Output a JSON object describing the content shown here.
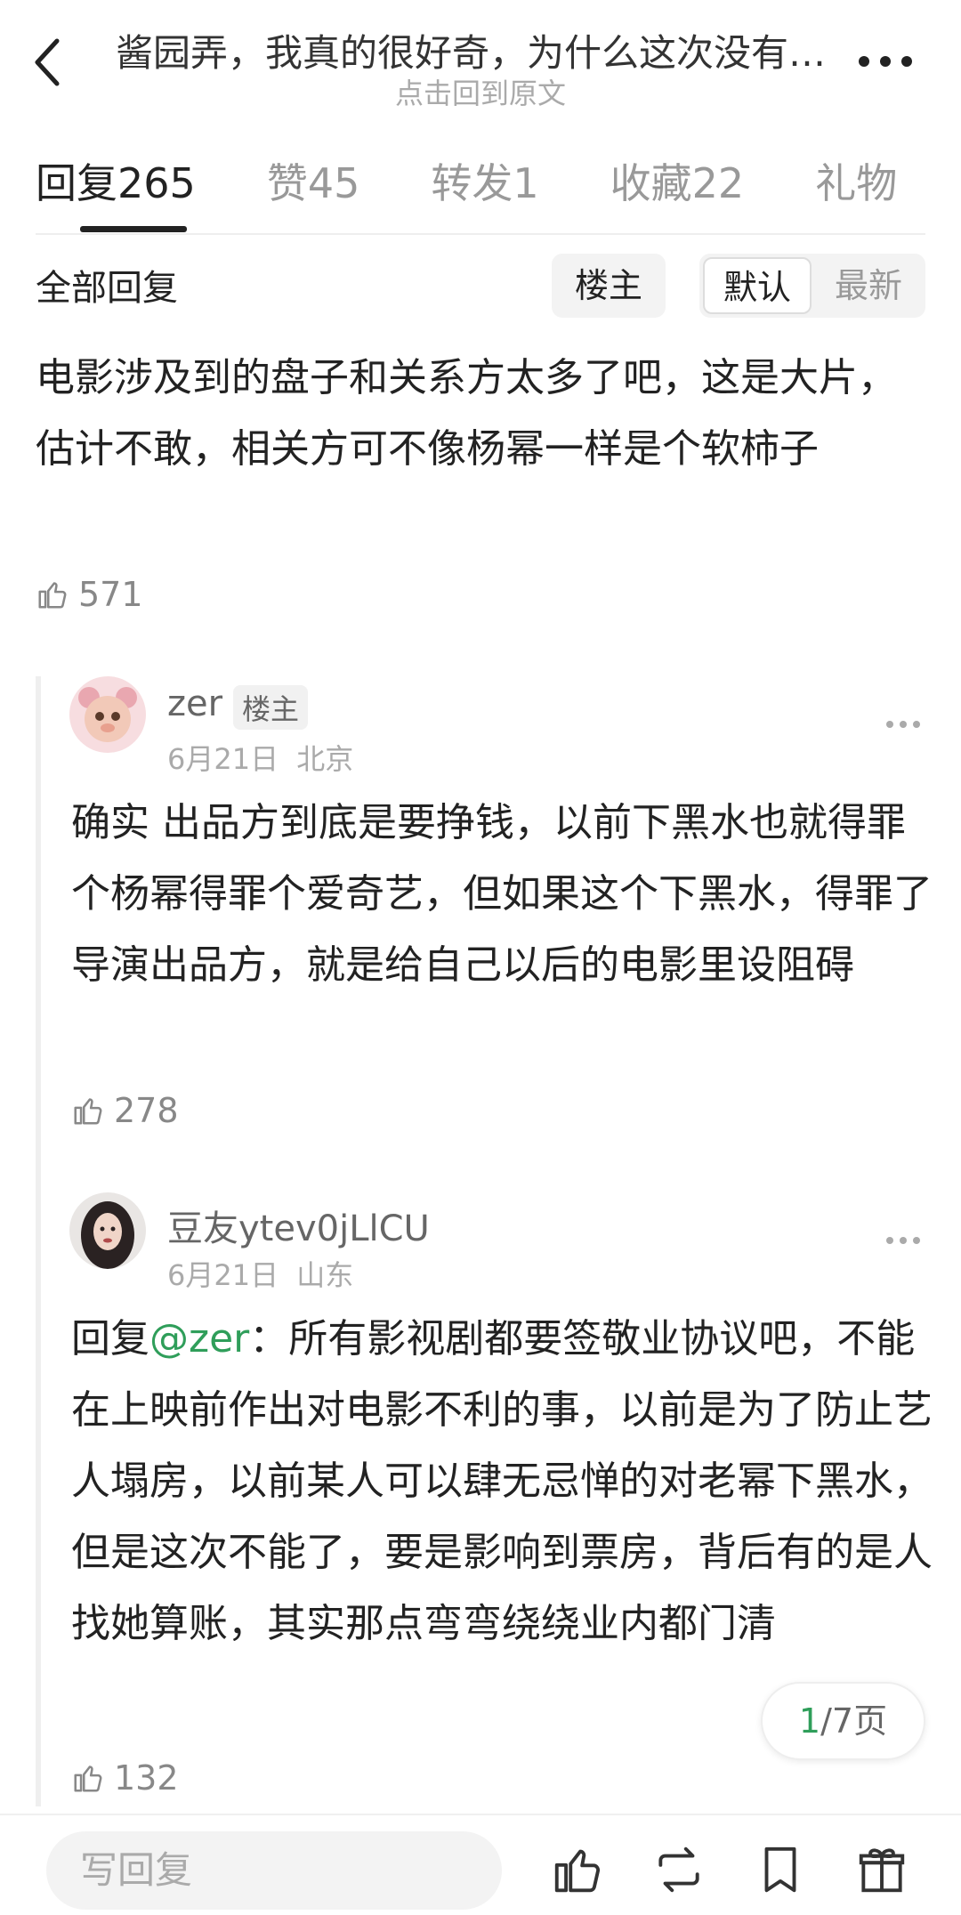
{
  "header": {
    "title": "酱园弄，我真的很好奇，为什么这次没有…",
    "subtitle": "点击回到原文"
  },
  "tabs": [
    {
      "label": "回复",
      "count": "265"
    },
    {
      "label": "赞",
      "count": "45"
    },
    {
      "label": "转发",
      "count": "1"
    },
    {
      "label": "收藏",
      "count": "22"
    },
    {
      "label": "礼物",
      "count": ""
    }
  ],
  "filter": {
    "label": "全部回复",
    "op_chip": "楼主",
    "sort_default": "默认",
    "sort_latest": "最新"
  },
  "main_comment": {
    "text": "电影涉及到的盘子和关系方太多了吧，这是大片，估计不敢，相关方可不像杨幂一样是个软柿子",
    "likes": "571"
  },
  "replies": [
    {
      "username": "zer",
      "badge": "楼主",
      "date": "6月21日",
      "location": "北京",
      "text": "确实 出品方到底是要挣钱，以前下黑水也就得罪个杨幂得罪个爱奇艺，但如果这个下黑水，得罪了导演出品方，就是给自己以后的电影里设阻碍",
      "likes": "278"
    },
    {
      "username": "豆友ytev0jLlCU",
      "date": "6月21日",
      "location": "山东",
      "reply_prefix": "回复",
      "mention": "@zer",
      "text": "：所有影视剧都要签敬业协议吧，不能在上映前作出对电影不利的事，以前是为了防止艺人塌房，以前某人可以肆无忌惮的对老幂下黑水，但是这次不能了，要是影响到票房，背后有的是人找她算账，其实那点弯弯绕绕业内都门清",
      "likes": "132"
    }
  ],
  "pager": {
    "current": "1",
    "total": "/7页"
  },
  "bottom": {
    "reply_placeholder": "写回复"
  },
  "colors": {
    "accent_green": "#2f9e5a",
    "text": "#222222",
    "muted": "#999999"
  }
}
